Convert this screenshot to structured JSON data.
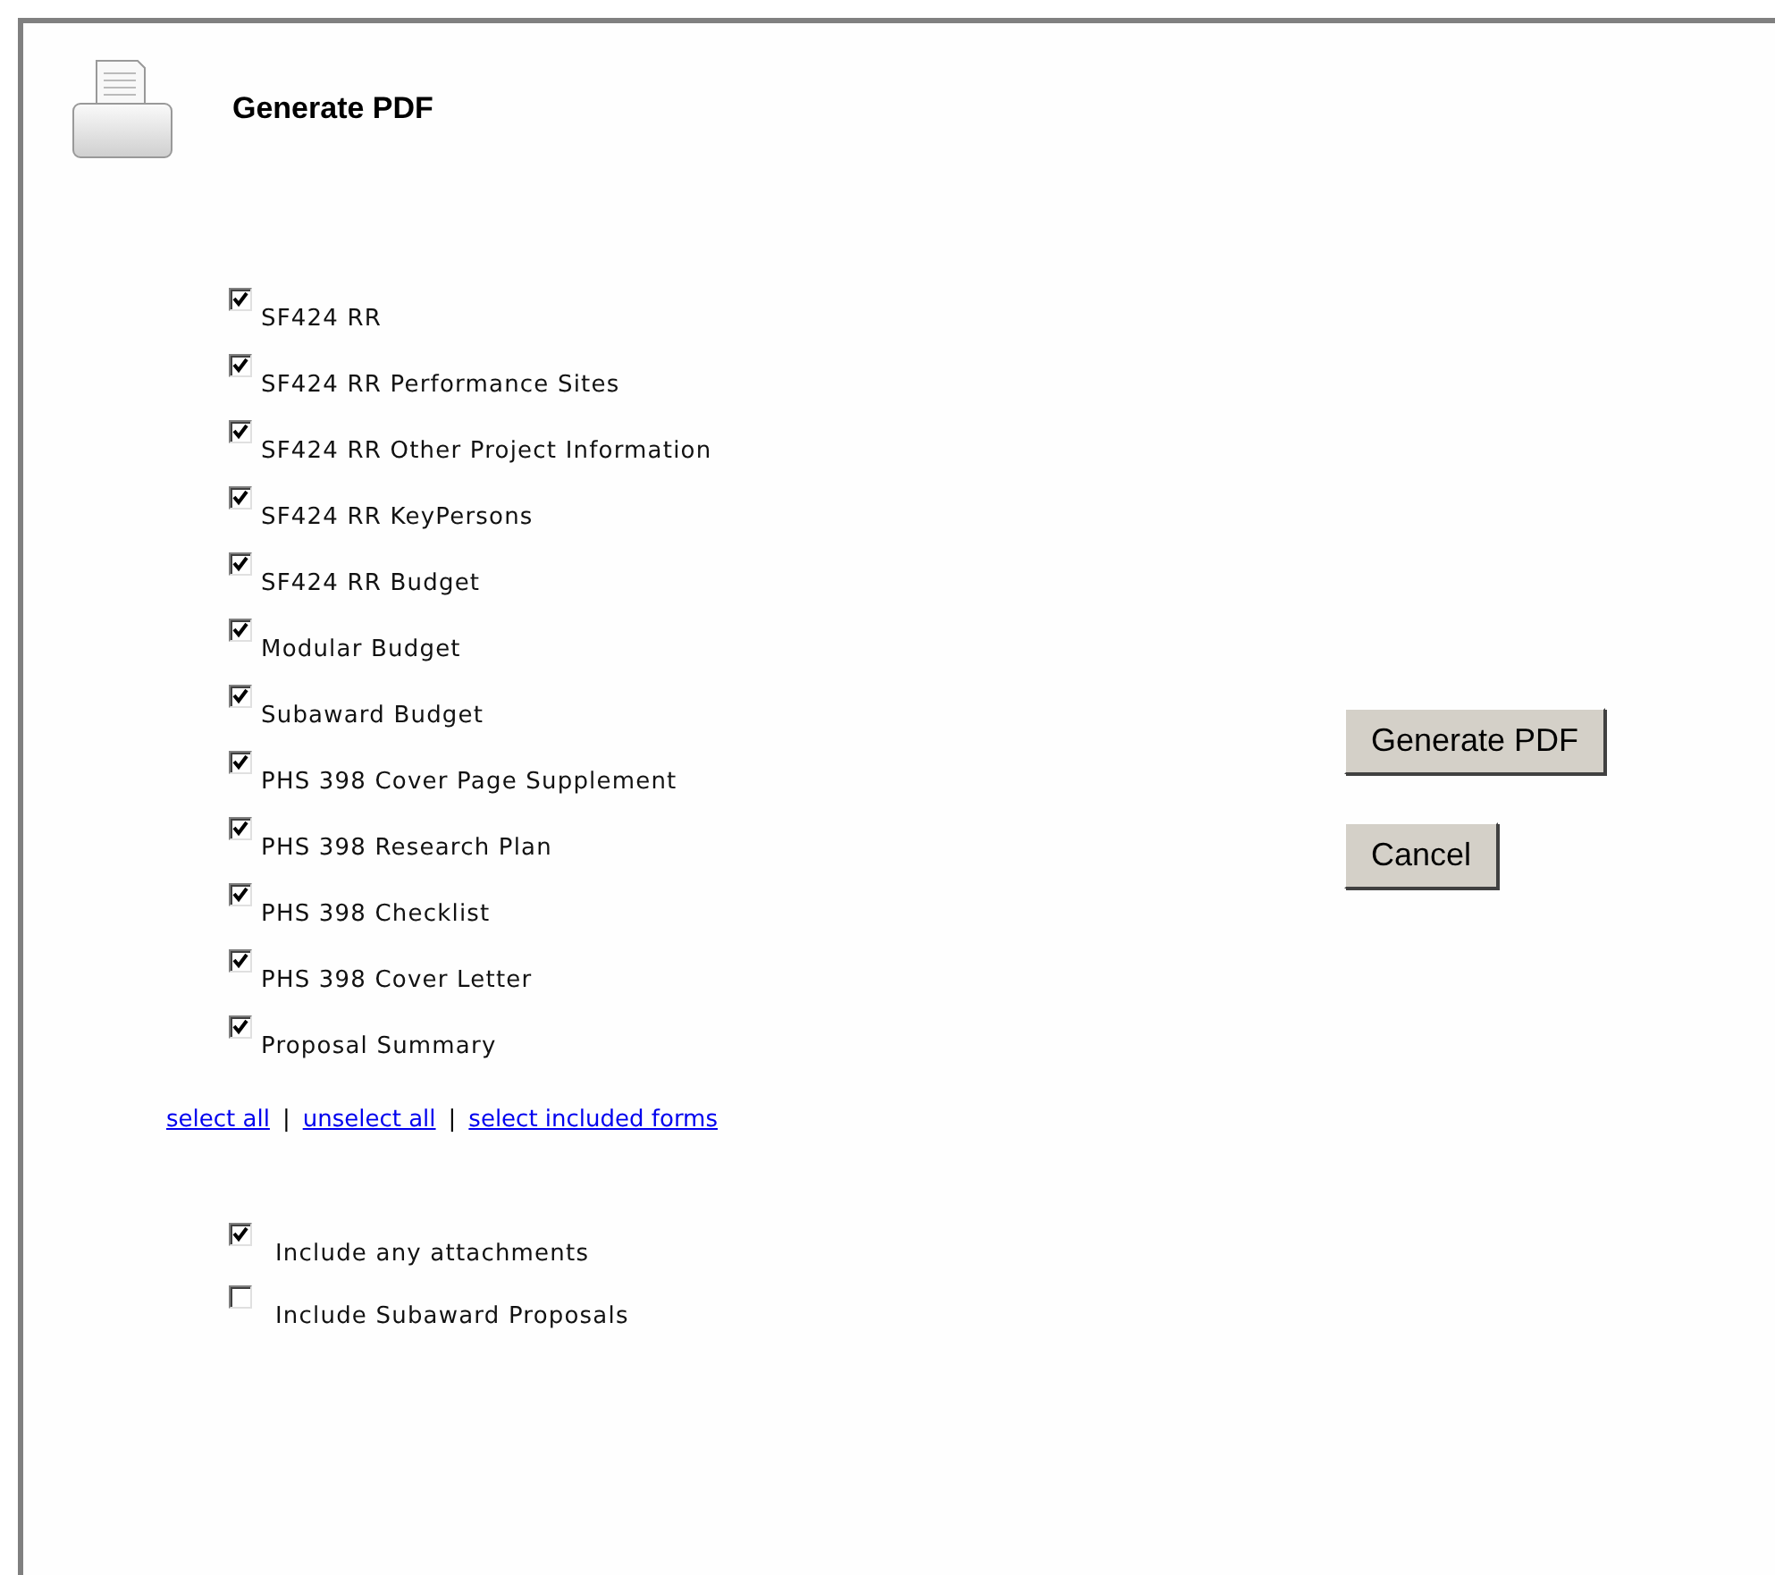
{
  "title": "Generate PDF",
  "forms": [
    {
      "label": "SF424 RR",
      "checked": true
    },
    {
      "label": "SF424 RR Performance Sites",
      "checked": true
    },
    {
      "label": "SF424 RR Other Project Information",
      "checked": true
    },
    {
      "label": "SF424 RR KeyPersons",
      "checked": true
    },
    {
      "label": "SF424 RR Budget",
      "checked": true
    },
    {
      "label": "Modular Budget",
      "checked": true
    },
    {
      "label": "Subaward Budget",
      "checked": true
    },
    {
      "label": "PHS 398 Cover Page Supplement",
      "checked": true
    },
    {
      "label": "PHS 398 Research Plan",
      "checked": true
    },
    {
      "label": "PHS 398 Checklist",
      "checked": true
    },
    {
      "label": "PHS 398 Cover Letter",
      "checked": true
    },
    {
      "label": "Proposal Summary",
      "checked": true
    }
  ],
  "links": [
    "select all",
    "unselect all",
    "select included forms"
  ],
  "link_separator": "|",
  "options": [
    {
      "label": "Include any attachments",
      "checked": true
    },
    {
      "label": "Include Subaward Proposals",
      "checked": false
    }
  ],
  "buttons": [
    "Generate PDF",
    "Cancel"
  ]
}
